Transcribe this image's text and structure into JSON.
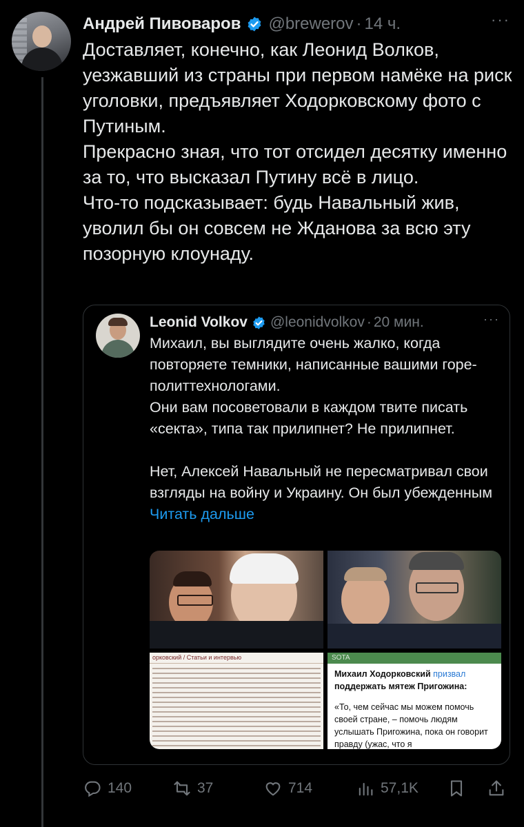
{
  "author": {
    "name": "Андрей Пивоваров",
    "handle": "@brewerov",
    "separator": "·",
    "time": "14 ч.",
    "more": "···"
  },
  "tweet": {
    "paragraphs": [
      "Доставляет, конечно, как Леонид Волков, уезжавший из страны при первом намёке на риск уголовки, предъявляет Ходорковскому фото с Путиным.",
      "Прекрасно зная, что тот отсидел десятку именно за то, что высказал Путину всё в лицо.",
      "Что-то подсказывает: будь Навальный жив, уволил бы он совсем не Жданова за всю эту позорную клоунаду."
    ]
  },
  "quote": {
    "name": "Leonid Volkov",
    "handle": "@leonidvolkov",
    "separator": "·",
    "time": "20 мин.",
    "more": "···",
    "paragraph1": "Михаил, вы выглядите очень жалко, когда повторяете темники, написанные вашими горе-политтехнологами.",
    "paragraph2": "Они вам посоветовали в каждом твите писать «секта», типа так прилипнет? Не прилипнет.",
    "paragraph3": "Нет, Алексей Навальный не пересматривал свои взгляды на войну и Украину. Он был убежденным",
    "read_more": "Читать дальше",
    "media": {
      "article_header": "орковский / Статьи и интервью",
      "telegram_channel": "SOTA",
      "telegram_text_bold": "Михаил Ходорковский",
      "telegram_link": "призвал",
      "telegram_text_bold2": "поддержать мятеж Пригожина:",
      "telegram_quote": "«То, чем сейчас мы можем помочь своей стране, – помочь людям услышать Пригожина, пока он говорит правду (ужас, что я"
    }
  },
  "actions": {
    "replies": "140",
    "reposts": "37",
    "likes": "714",
    "views": "57,1K"
  },
  "colors": {
    "background": "#000000",
    "text": "#e7e9ea",
    "muted": "#71767b",
    "link": "#1d9bf0",
    "verified": "#1d9bf0",
    "border": "#2f3336"
  }
}
